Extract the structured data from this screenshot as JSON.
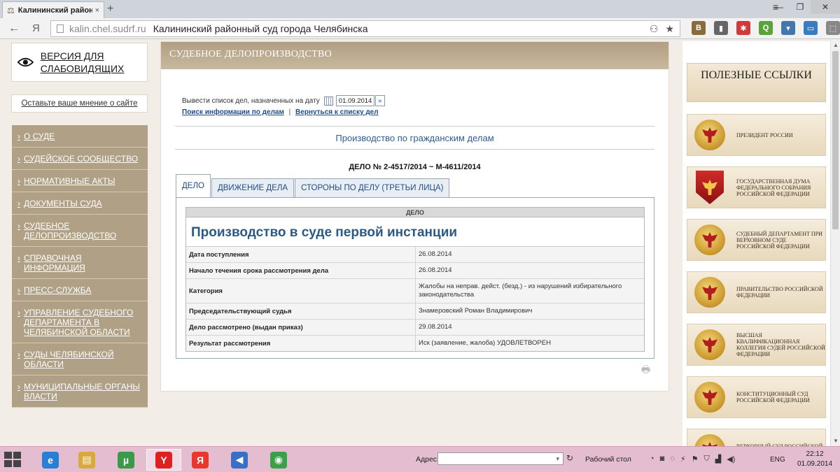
{
  "browser": {
    "tab_title": "Калининский районн",
    "tab_close": "×",
    "new_tab": "+",
    "url": "kalin.chel.sudrf.ru",
    "page_title": "Калининский районный суд города Челябинска",
    "back": "←",
    "yandex": "Я",
    "menu": "≡",
    "minimize": "—",
    "restore": "❐",
    "close": "✕",
    "bookmark_star": "★",
    "extensions": [
      {
        "label": "B",
        "color": "#8a6b3b"
      },
      {
        "label": "▮",
        "color": "#666666"
      },
      {
        "label": "✱",
        "color": "#d23a3a"
      },
      {
        "label": "Q",
        "color": "#5aa33a"
      },
      {
        "label": "▾",
        "color": "#4477aa"
      },
      {
        "label": "▭",
        "color": "#3b7bbf"
      },
      {
        "label": "⬚",
        "color": "#888888"
      }
    ]
  },
  "sidebar": {
    "accessibility": "ВЕРСИЯ ДЛЯ СЛАБОВИДЯЩИХ",
    "feedback": "Оставьте ваше мнение о сайте",
    "menu": [
      "О СУДЕ",
      "СУДЕЙСКОЕ СООБЩЕСТВО",
      "НОРМАТИВНЫЕ АКТЫ",
      "ДОКУМЕНТЫ СУДА",
      "СУДЕБНОЕ ДЕЛОПРОИЗВОДСТВО",
      "СПРАВОЧНАЯ ИНФОРМАЦИЯ",
      "ПРЕСС-СЛУЖБА",
      "УПРАВЛЕНИЕ СУДЕБНОГО ДЕПАРТАМЕНТА В ЧЕЛЯБИНСКОЙ ОБЛАСТИ",
      "СУДЫ ЧЕЛЯБИНСКОЙ ОБЛАСТИ",
      "МУНИЦИПАЛЬНЫЕ ОРГАНЫ ВЛАСТИ"
    ]
  },
  "main": {
    "header": "СУДЕБНОЕ ДЕЛОПРОИЗВОДСТВО",
    "date_label": "Вывести список дел, назначенных на дату",
    "date_value": "01.09.2014",
    "link_search": "Поиск информации по делам",
    "link_separator": "|",
    "link_back": "Вернуться к списку дел",
    "section_title": "Производство по гражданским делам",
    "case_number": "ДЕЛО № 2-4517/2014 ~ М-4611/2014",
    "tabs": [
      "ДЕЛО",
      "ДВИЖЕНИЕ ДЕЛА",
      "СТОРОНЫ ПО ДЕЛУ (ТРЕТЬИ ЛИЦА)"
    ],
    "table": {
      "header": "ДЕЛО",
      "caption": "Производство в суде первой инстанции",
      "rows": [
        {
          "label": "Дата поступления",
          "value": "26.08.2014"
        },
        {
          "label": "Начало течения срока рассмотрения дела",
          "value": "26.08.2014"
        },
        {
          "label": "Категория",
          "value": "Жалобы на неправ. дейст. (безд.) - из нарушений избирательного законодательства"
        },
        {
          "label": "Председательствующий судья",
          "value": "Знамеровский Роман Владимирович"
        },
        {
          "label": "Дело рассмотрено (выдан приказ)",
          "value": "29.08.2014"
        },
        {
          "label": "Результат рассмотрения",
          "value": "Иск (заявление, жалоба) УДОВЛЕТВОРЕН"
        }
      ]
    }
  },
  "right": {
    "title": "ПОЛЕЗНЫЕ ССЫЛКИ",
    "links": [
      {
        "text": "ПРЕЗИДЕНТ РОССИИ",
        "emblem": "seal"
      },
      {
        "text": "ГОСУДАРСТВЕННАЯ ДУМА ФЕДЕРАЛЬНОГО СОБРАНИЯ РОССИЙСКОЙ ФЕДЕРАЦИИ",
        "emblem": "shield"
      },
      {
        "text": "СУДЕБНЫЙ ДЕПАРТАМЕНТ ПРИ ВЕРХОВНОМ СУДЕ РОССИЙСКОЙ ФЕДЕРАЦИИ",
        "emblem": "seal"
      },
      {
        "text": "ПРАВИТЕЛЬСТВО РОССИЙСКОЙ ФЕДЕРАЦИИ",
        "emblem": "seal"
      },
      {
        "text": "ВЫСШАЯ КВАЛИФИКАЦИОННАЯ КОЛЛЕГИЯ СУДЕЙ РОССИЙСКОЙ ФЕДЕРАЦИИ",
        "emblem": "seal"
      },
      {
        "text": "КОНСТИТУЦИОННЫЙ СУД РОССИЙСКОЙ ФЕДЕРАЦИИ",
        "emblem": "seal"
      },
      {
        "text": "ВЕРХОВНЫЙ СУД РОССИЙСКОЙ ФЕДЕРАЦИИ",
        "emblem": "seal"
      }
    ]
  },
  "taskbar": {
    "apps": [
      {
        "name": "ie",
        "glyph": "e",
        "color": "#2a7fd4"
      },
      {
        "name": "explorer",
        "glyph": "▤",
        "color": "#d9a93b"
      },
      {
        "name": "utorrent",
        "glyph": "µ",
        "color": "#3a9a4a"
      },
      {
        "name": "yandex-browser",
        "glyph": "Y",
        "color": "#e02020"
      },
      {
        "name": "yandex",
        "glyph": "Я",
        "color": "#e8372b"
      },
      {
        "name": "media",
        "glyph": "◀",
        "color": "#3a6fc8"
      },
      {
        "name": "chrome",
        "glyph": "◉",
        "color": "#3aa04a"
      }
    ],
    "address_label": "Адрес",
    "desktop_label": "Рабочий стол",
    "lang": "ENG",
    "time": "22:12",
    "date": "01.09.2014"
  }
}
